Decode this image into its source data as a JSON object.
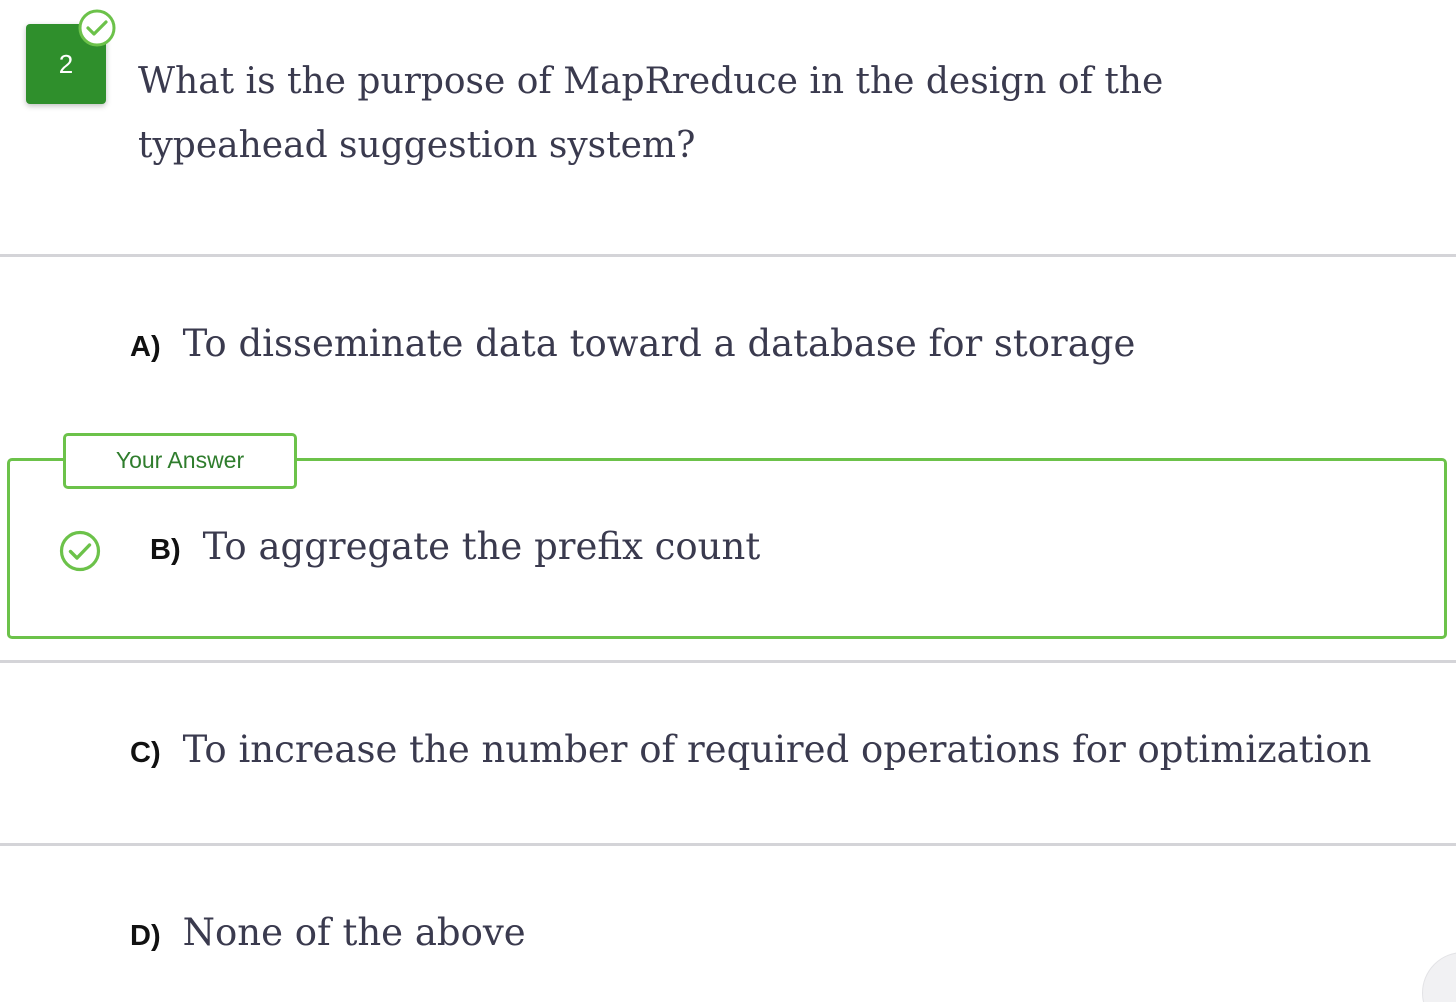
{
  "question": {
    "number": "2",
    "status": "answered-correct",
    "text": "What is the purpose of MapRreduce in the design of the typeahead suggestion system?"
  },
  "options": [
    {
      "letter": "A)",
      "text": "To disseminate data toward a database for storage"
    },
    {
      "letter": "B)",
      "text": "To aggregate the prefix count",
      "selected": true,
      "correct": true
    },
    {
      "letter": "C)",
      "text": "To increase the number of required operations for optimization"
    },
    {
      "letter": "D)",
      "text": "None of the above"
    }
  ],
  "answer_tag": "Your Answer",
  "icons": {
    "badge": "check-circle-icon",
    "answer": "check-circle-icon"
  },
  "colors": {
    "badge_bg": "#2f8f2c",
    "accent_green": "#6cc24a",
    "tag_text": "#2f7d2d",
    "text": "#3a3a4e",
    "divider": "#d4d4d8"
  }
}
